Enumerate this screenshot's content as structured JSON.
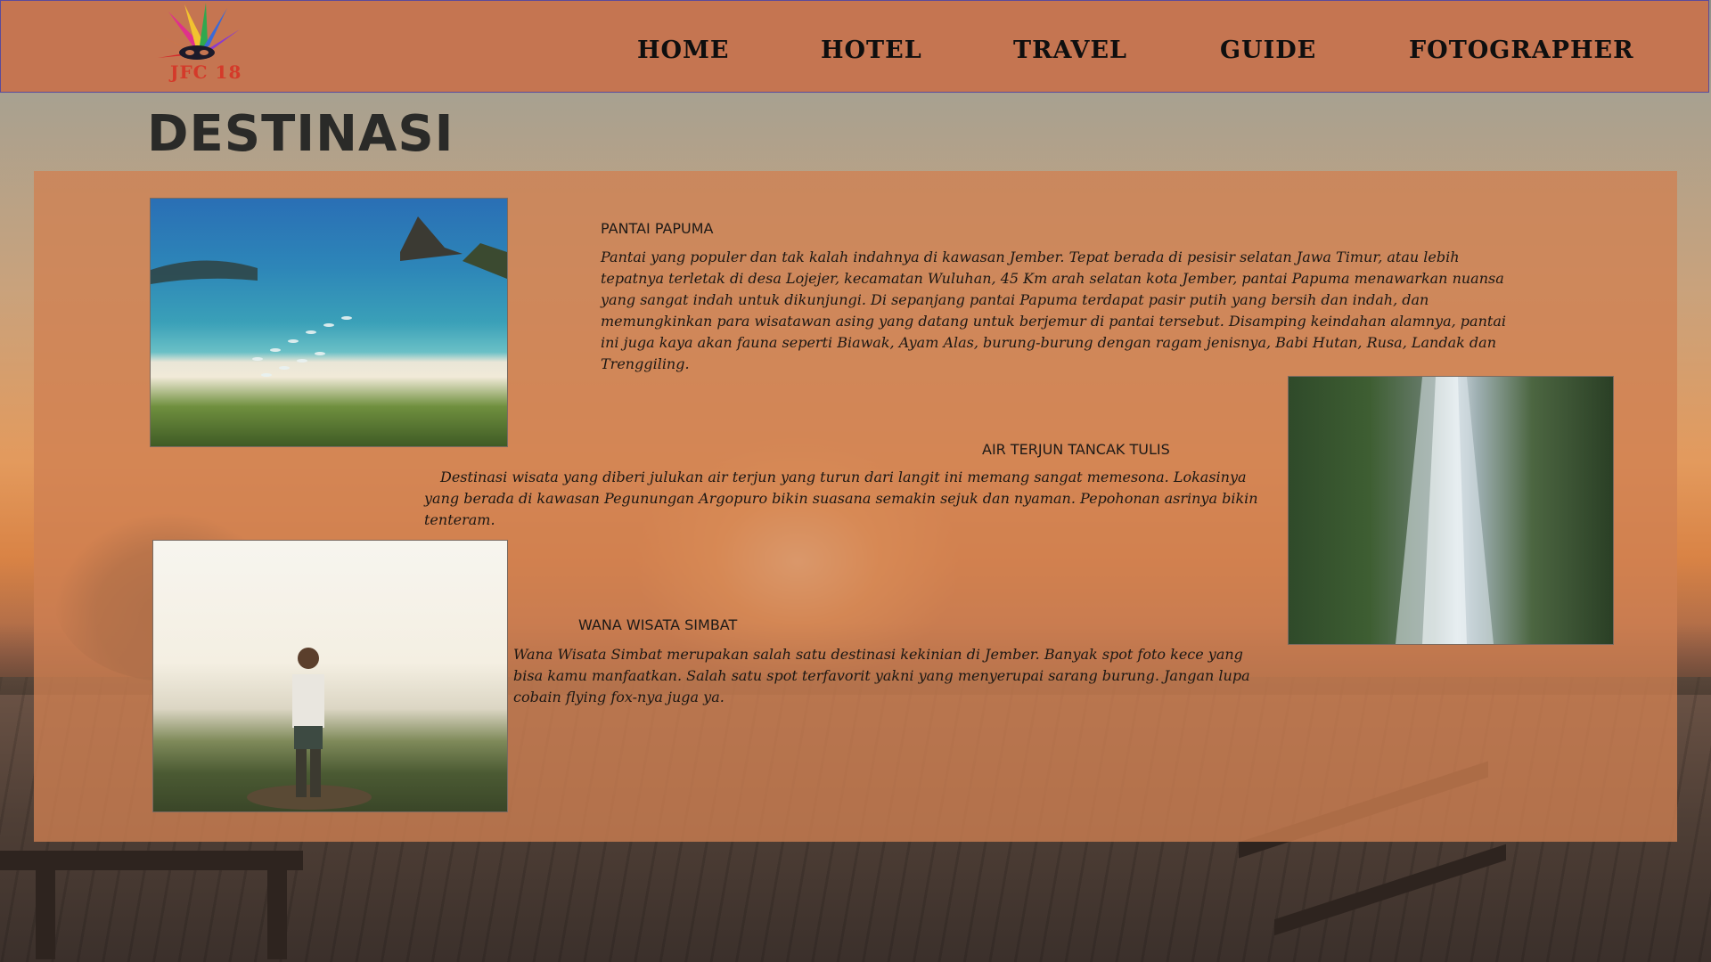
{
  "header": {
    "logo_text": "JFC 18",
    "nav": [
      "HOME",
      "HOTEL",
      "TRAVEL",
      "GUIDE",
      "FOTOGRAPHER"
    ]
  },
  "page_title": "DESTINASI",
  "destinations": [
    {
      "name": "PANTAI PAPUMA",
      "description": " Pantai yang populer dan tak kalah indahnya di kawasan Jember. Tepat berada di pesisir selatan Jawa Timur, atau lebih tepatnya terletak di desa Lojejer, kecamatan Wuluhan, 45 Km arah selatan kota Jember, pantai Papuma menawarkan nuansa yang sangat indah untuk dikunjungi. Di sepanjang pantai Papuma terdapat pasir putih yang bersih dan indah, dan memungkinkan para wisatawan asing yang datang untuk berjemur di pantai tersebut. Disamping keindahan alamnya, pantai ini juga kaya akan fauna seperti Biawak, Ayam Alas, burung-burung dengan ragam jenisnya, Babi Hutan, Rusa, Landak dan Trenggiling."
    },
    {
      "name": "AIR TERJUN TANCAK TULIS",
      "description": "Destinasi wisata yang diberi julukan air terjun yang turun dari langit ini memang sangat memesona. Lokasinya yang berada di kawasan Pegunungan Argopuro bikin suasana semakin sejuk dan nyaman. Pepohonan asrinya bikin tenteram."
    },
    {
      "name": "WANA WISATA SIMBAT",
      "description": "Wana Wisata Simbat merupakan salah satu destinasi kekinian di Jember. Banyak spot foto kece yang bisa kamu manfaatkan. Salah satu spot terfavorit yakni yang menyerupai sarang burung. Jangan lupa cobain flying fox-nya juga ya."
    }
  ]
}
